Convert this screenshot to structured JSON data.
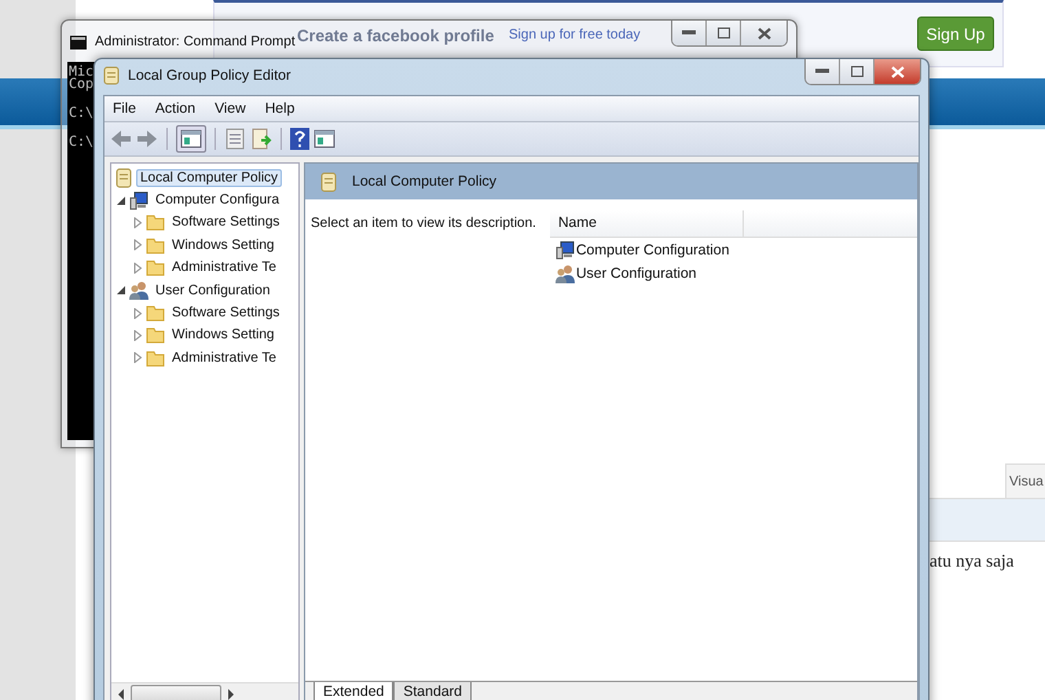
{
  "webpage": {
    "banner": {
      "headline": "Create a facebook profile",
      "link": "Sign up for free today",
      "button": "Sign Up"
    },
    "editor_tab": "Visua",
    "body_text": "atu nya saja"
  },
  "cmd_window": {
    "title": "Administrator: Command Prompt",
    "lines": [
      "Mic",
      "Cop",
      "C:\\",
      "C:\\"
    ]
  },
  "gpedit": {
    "title": "Local Group Policy Editor",
    "menu": [
      "File",
      "Action",
      "View",
      "Help"
    ],
    "tree": [
      {
        "label": "Local Computer Policy",
        "kind": "policy",
        "selected": true,
        "children": [
          {
            "label": "Computer Configura",
            "kind": "computer",
            "selected": false,
            "expanded": true,
            "children": [
              {
                "label": "Software Settings",
                "kind": "folder",
                "selected": false,
                "expanded": false
              },
              {
                "label": "Windows Setting",
                "kind": "folder",
                "selected": false,
                "expanded": false
              },
              {
                "label": "Administrative Te",
                "kind": "folder",
                "selected": false,
                "expanded": false
              }
            ]
          },
          {
            "label": "User Configuration",
            "kind": "user",
            "selected": false,
            "expanded": true,
            "children": [
              {
                "label": "Software Settings",
                "kind": "folder",
                "selected": false,
                "expanded": false
              },
              {
                "label": "Windows Setting",
                "kind": "folder",
                "selected": false,
                "expanded": false
              },
              {
                "label": "Administrative Te",
                "kind": "folder",
                "selected": false,
                "expanded": false
              }
            ]
          }
        ]
      }
    ],
    "details": {
      "header": "Local Computer Policy",
      "description": "Select an item to view its description.",
      "columns": [
        "Name"
      ],
      "rows": [
        {
          "name": "Computer Configuration",
          "kind": "computer"
        },
        {
          "name": "User Configuration",
          "kind": "user"
        }
      ]
    },
    "view_tabs": [
      {
        "label": "Extended",
        "selected": true
      },
      {
        "label": "Standard",
        "selected": false
      }
    ]
  }
}
